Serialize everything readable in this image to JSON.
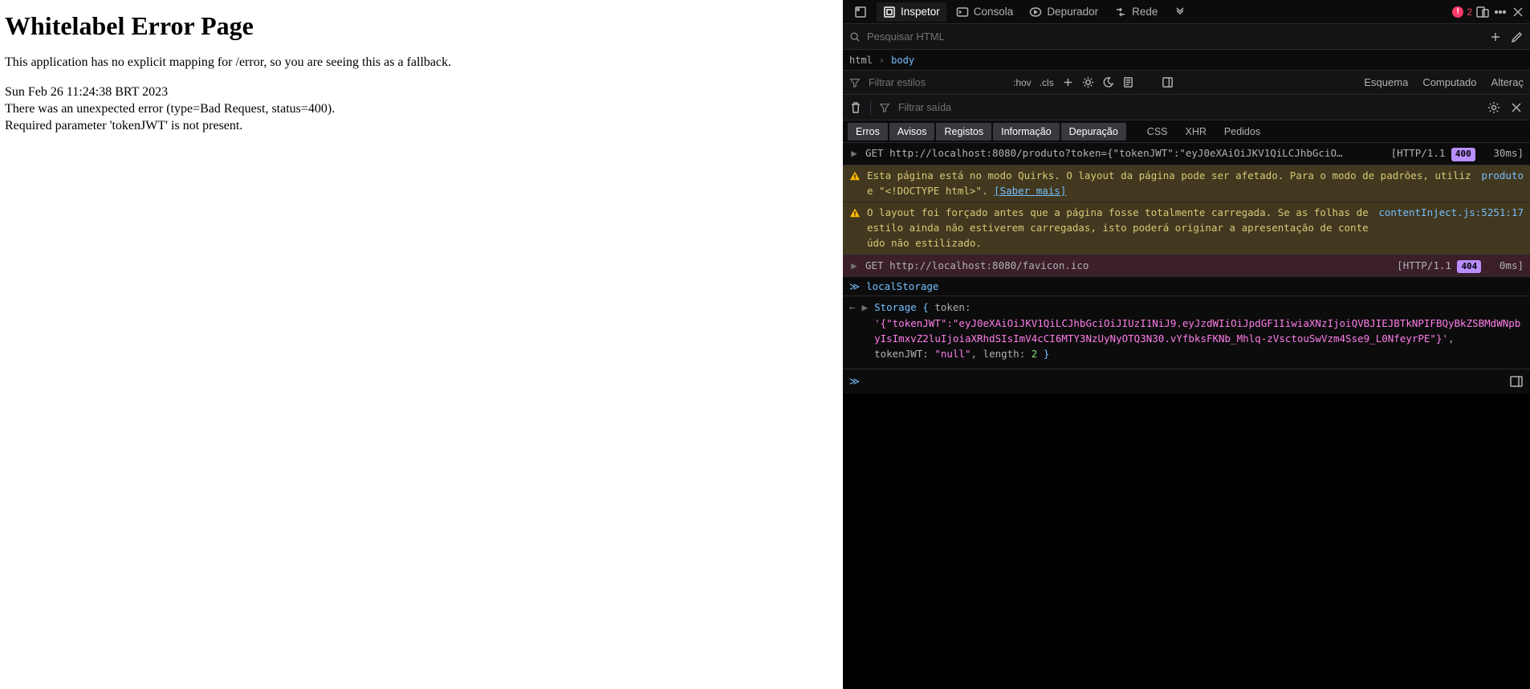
{
  "page": {
    "title": "Whitelabel Error Page",
    "fallback": "This application has no explicit mapping for /error, so you are seeing this as a fallback.",
    "timestamp": "Sun Feb 26 11:24:38 BRT 2023",
    "error_line": "There was an unexpected error (type=Bad Request, status=400).",
    "detail": "Required parameter 'tokenJWT' is not present."
  },
  "toolbar": {
    "inspector": "Inspetor",
    "console": "Consola",
    "debugger": "Depurador",
    "network": "Rede",
    "error_count": "2"
  },
  "search": {
    "placeholder": "Pesquisar HTML"
  },
  "crumbs": {
    "root": "html",
    "child": "body"
  },
  "styles": {
    "filter_placeholder": "Filtrar estilos",
    "hov": ":hov",
    "cls": ".cls",
    "tab_layout": "Esquema",
    "tab_computed": "Computado",
    "tab_changes": "Alteraç"
  },
  "console_toolbar": {
    "filter_placeholder": "Filtrar saída"
  },
  "ctabs": {
    "errors": "Erros",
    "warnings": "Avisos",
    "logs": "Registos",
    "info": "Informação",
    "debug": "Depuração",
    "css": "CSS",
    "xhr": "XHR",
    "requests": "Pedidos"
  },
  "log1": {
    "method": "GET",
    "url": "http://localhost:8080/produto?token={\"tokenJWT\":\"eyJ0eXAiOiJKV1QiLCJhbGciO…",
    "proto": "[HTTP/1.1",
    "status": "400",
    "time": "30ms]"
  },
  "log2": {
    "text_a": "Esta página está no modo Quirks. O layout da página pode ser afetado. Para o modo de padrões, utilize \"<!DOCTYPE html>\". ",
    "learn": "[Saber mais]",
    "source": "produto"
  },
  "log3": {
    "text": "O layout foi forçado antes que a página fosse totalmente carregada. Se as folhas de estilo ainda não estiverem carregadas, isto poderá originar a apresentação de conteúdo não estilizado.",
    "source": "contentInject.js:5251:17"
  },
  "log4": {
    "method": "GET",
    "url": "http://localhost:8080/favicon.ico",
    "proto": "[HTTP/1.1",
    "status": "404",
    "time": "0ms]"
  },
  "cmd": {
    "text": "localStorage"
  },
  "out": {
    "prefix": "Storage { ",
    "key1": "token: ",
    "val1": "'{\"tokenJWT\":\"eyJ0eXAiOiJKV1QiLCJhbGciOiJIUzI1NiJ9.eyJzdWIiOiJpdGF1IiwiaXNzIjoiQVBJIEJBTkNPIFBQyBkZSBMdWNpbyIsImxvZ2luIjoiaXRhdSIsImV4cCI6MTY3NzUyNyOTQ3N30.vYfbksFKNb_Mhlq-zVsctouSwVzm4Sse9_L0NfeyrPE\"}'",
    "key2": "tokenJWT: ",
    "val2": "\"null\"",
    "key3": "length: ",
    "val3": "2",
    "suffix": " }"
  }
}
